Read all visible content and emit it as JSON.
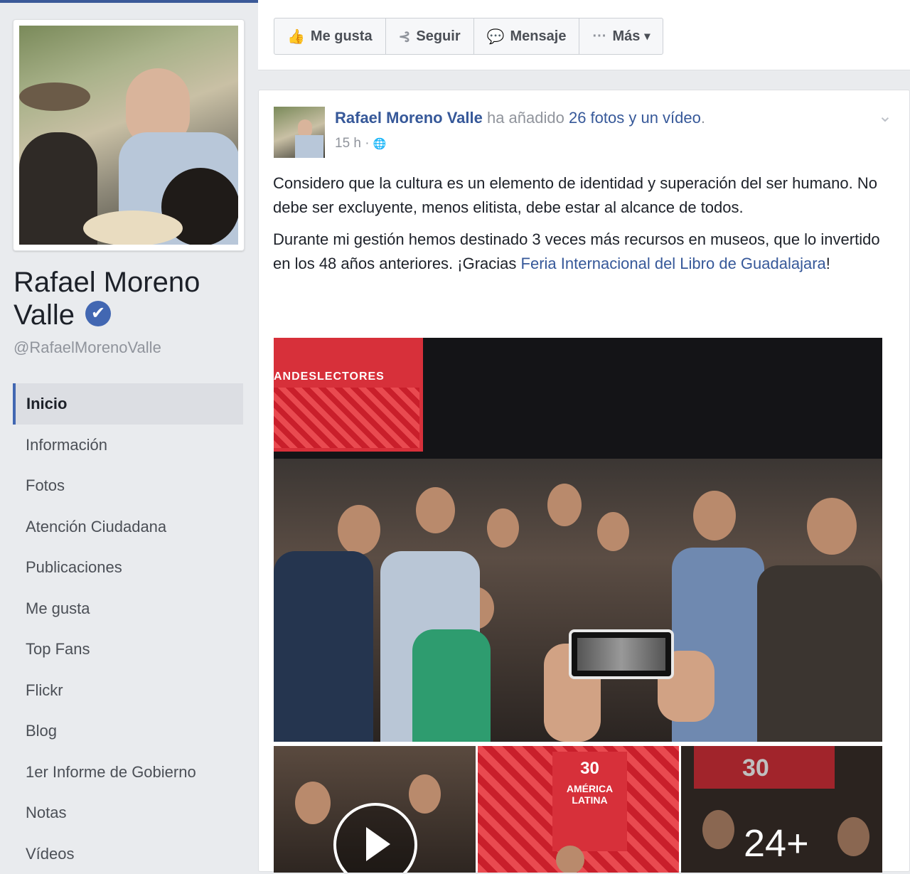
{
  "profile": {
    "name": "Rafael Moreno Valle",
    "name_line1": "Rafael Moreno",
    "name_line2": "Valle",
    "verified_glyph": "✔",
    "handle": "@RafaelMorenoValle"
  },
  "nav": {
    "items": [
      {
        "label": "Inicio",
        "active": true
      },
      {
        "label": "Información"
      },
      {
        "label": "Fotos"
      },
      {
        "label": "Atención Ciudadana"
      },
      {
        "label": "Publicaciones"
      },
      {
        "label": "Me gusta"
      },
      {
        "label": "Top Fans"
      },
      {
        "label": "Flickr"
      },
      {
        "label": "Blog"
      },
      {
        "label": "1er Informe de Gobierno"
      },
      {
        "label": "Notas"
      },
      {
        "label": "Vídeos"
      }
    ]
  },
  "actions": {
    "like": {
      "label": "Me gusta",
      "icon": "thumbs-up-icon",
      "glyph": "👍"
    },
    "follow": {
      "label": "Seguir",
      "icon": "rss-icon",
      "glyph": "⊰"
    },
    "message": {
      "label": "Mensaje",
      "icon": "messenger-icon",
      "glyph": "💬"
    },
    "more": {
      "label": "Más",
      "icon": "ellipsis-icon",
      "glyph": "···",
      "caret": "▾"
    }
  },
  "post": {
    "author": "Rafael Moreno Valle",
    "action_text": " ha añadido ",
    "added_link": "26 fotos y un vídeo",
    "period": ".",
    "time": "15 h",
    "meta_sep": " · ",
    "globe_glyph": "🌐",
    "chevron": "⌄",
    "paragraph1": "Considero que la cultura es un elemento de identidad y superación del ser humano. No debe ser excluyente, menos elitista, debe estar al alcance de todos.",
    "paragraph2_pre": "Durante mi gestión hemos destinado 3 veces más recursos en museos, que lo invertido en los 48 años anteriores. ¡Gracias ",
    "paragraph2_link": "Feria Internacional del Libro de Guadalajara",
    "paragraph2_post": "!",
    "photo_banner_text": "ANDESLECTORES",
    "thumb2_number": "30",
    "thumb2_text": "AMÉRICA LATINA",
    "thumb3_number": "30",
    "more_count": "24+"
  },
  "colors": {
    "brand": "#3b5998",
    "link": "#365899",
    "accent_red": "#d7303a"
  }
}
